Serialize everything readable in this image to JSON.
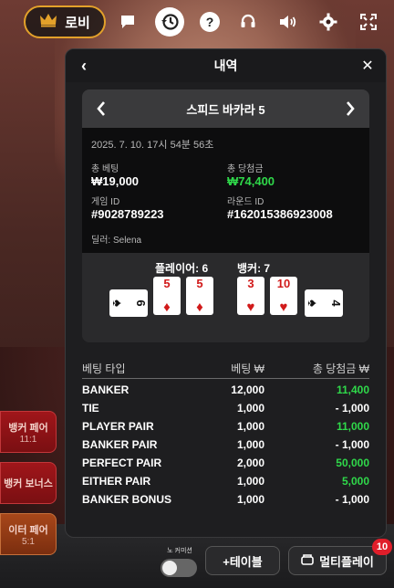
{
  "topbar": {
    "lobby_label": "로비",
    "icons": [
      "crown-icon",
      "chat-icon",
      "history-icon",
      "help-icon",
      "headset-icon",
      "sound-icon",
      "settings-icon",
      "fullscreen-icon"
    ],
    "help_glyph": "?"
  },
  "panel": {
    "title": "내역",
    "back_glyph": "‹",
    "close_glyph": "✕"
  },
  "round": {
    "game_name": "스피드 바카라 5",
    "timestamp": "2025. 7. 10. 17시 54분 56초",
    "total_bet_label": "총 베팅",
    "total_bet_value": "₩19,000",
    "total_win_label": "총 당첨금",
    "total_win_value": "₩74,400",
    "game_id_label": "게임 ID",
    "game_id_value": "#9028789223",
    "round_id_label": "라운드 ID",
    "round_id_value": "#162015386923008",
    "dealer": "딜러: Selena"
  },
  "cards": {
    "player_label": "플레이어: 6",
    "banker_label": "뱅커: 7",
    "player": [
      {
        "rank": "6",
        "suit": "♠",
        "color": "black",
        "rotated": true
      },
      {
        "rank": "5",
        "suit": "♦",
        "color": "red",
        "rotated": false
      },
      {
        "rank": "5",
        "suit": "♦",
        "color": "red",
        "rotated": false
      }
    ],
    "banker": [
      {
        "rank": "3",
        "suit": "♥",
        "color": "red",
        "rotated": false
      },
      {
        "rank": "10",
        "suit": "♥",
        "color": "red",
        "rotated": false
      },
      {
        "rank": "4",
        "suit": "♠",
        "color": "black",
        "rotated": true
      }
    ]
  },
  "bets": {
    "headers": [
      "베팅 타입",
      "베팅 ₩",
      "총 당첨금 ₩"
    ],
    "rows": [
      {
        "type": "BANKER",
        "bet": "12,000",
        "win": "11,400",
        "positive": true
      },
      {
        "type": "TIE",
        "bet": "1,000",
        "win": "- 1,000",
        "positive": false
      },
      {
        "type": "PLAYER PAIR",
        "bet": "1,000",
        "win": "11,000",
        "positive": true
      },
      {
        "type": "BANKER PAIR",
        "bet": "1,000",
        "win": "- 1,000",
        "positive": false
      },
      {
        "type": "PERFECT PAIR",
        "bet": "2,000",
        "win": "50,000",
        "positive": true
      },
      {
        "type": "EITHER PAIR",
        "bet": "1,000",
        "win": "5,000",
        "positive": true
      },
      {
        "type": "BANKER BONUS",
        "bet": "1,000",
        "win": "- 1,000",
        "positive": false
      }
    ]
  },
  "background_spots": [
    {
      "label": "뱅커 페어",
      "sub": "11:1"
    },
    {
      "label": "뱅커 보너스",
      "sub": ""
    },
    {
      "label": "이터 페어",
      "sub": "5:1"
    }
  ],
  "bottom": {
    "toggle_label": "노 커미션",
    "table_button": "+테이블",
    "multiplay_button": "멀티플레이",
    "multiplay_badge": "10"
  },
  "colors": {
    "accent_gold": "#e3a12a",
    "win_green": "#2fd94a",
    "badge_red": "#e01e2a"
  }
}
